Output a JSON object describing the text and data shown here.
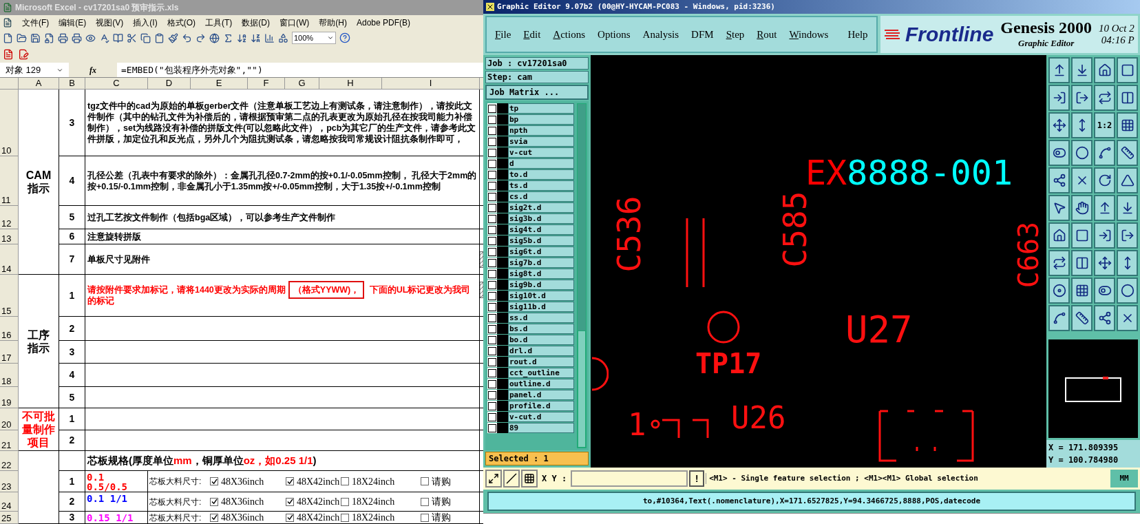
{
  "excel": {
    "title": "Microsoft Excel - cv17201sa0 预审指示.xls",
    "menu": [
      "文件(F)",
      "编辑(E)",
      "视图(V)",
      "插入(I)",
      "格式(O)",
      "工具(T)",
      "数据(D)",
      "窗口(W)",
      "帮助(H)",
      "Adobe PDF(B)"
    ],
    "zoom": "100%",
    "name_box": "对象 129",
    "function_label": "fx",
    "formula": "=EMBED(\"包装程序外壳对象\",\"\")",
    "columns": [
      "A",
      "B",
      "C",
      "D",
      "E",
      "F",
      "G",
      "H",
      "I"
    ],
    "sections": [
      {
        "label": [
          "CAM",
          "指示"
        ],
        "color": "#000000",
        "rows": [
          {
            "number": "10",
            "item": "3",
            "kind": "note",
            "color": "#000000",
            "parts": [
              {
                "text": "tgz文件中的cad为原始的单板gerber文件（注意单板工艺边上有测试条，请注意制作），请按此文件制作（其中的钻孔文件为补偿后的，请根据预审第二点的孔表更改为原始孔径在按我司能力补偿制作），set为线路没有补偿的拼版文件(可以忽略此文件），pcb为其它厂的生产文件，请参考此文件拼版，加定位孔和反光点，另外几个为阻抗测试条，请忽略按我司常规设计阻抗条制作即可，",
                "boxed": false
              }
            ]
          },
          {
            "number": "11",
            "item": "4",
            "kind": "note",
            "color": "#000000",
            "parts": [
              {
                "text": "孔径公差（孔表中有要求的除外）：金属孔孔径0.7-2mm的按+0.1/-0.05mm控制， 孔径大于2mm的按+0.15/-0.1mm控制，非金属孔小于1.35mm按+/-0.05mm控制，大于1.35按+/-0.1mm控制",
                "boxed": false
              }
            ]
          },
          {
            "number": "12",
            "item": "5",
            "kind": "note",
            "color": "#000000",
            "parts": [
              {
                "text": "过孔工艺按文件制作（包括bga区域），可以参考生产文件制作",
                "boxed": false
              }
            ]
          },
          {
            "number": "13",
            "item": "6",
            "kind": "note",
            "color": "#000000",
            "parts": [
              {
                "text": "注意旋转拼版",
                "boxed": false
              }
            ]
          },
          {
            "number": "14",
            "item": "7",
            "kind": "note",
            "color": "#000000",
            "has_object": true,
            "parts": [
              {
                "text": "单板尺寸见附件",
                "boxed": false
              }
            ]
          }
        ]
      },
      {
        "label": [
          "工序",
          "指示"
        ],
        "color": "#000000",
        "rows": [
          {
            "number": "15",
            "item": "1",
            "kind": "note",
            "color": "#ff0000",
            "has_object": true,
            "parts": [
              {
                "text": "请按附件要求加标记，请将1440更改为实际的周期",
                "boxed": false
              },
              {
                "text": "（格式YYWW)，",
                "boxed": true
              },
              {
                "text": " 下面的UL标记更改为我司的标记",
                "boxed": false
              }
            ]
          },
          {
            "number": "16",
            "item": "2",
            "kind": "note",
            "color": "#000000"
          },
          {
            "number": "17",
            "item": "3",
            "kind": "note",
            "color": "#000000"
          },
          {
            "number": "18",
            "item": "4",
            "kind": "note",
            "color": "#000000"
          },
          {
            "number": "19",
            "item": "5",
            "kind": "note",
            "color": "#000000"
          }
        ]
      },
      {
        "label": [
          "不可批",
          "量制作",
          "项目"
        ],
        "color": "#ff0000",
        "rows": [
          {
            "number": "20",
            "item": "1",
            "kind": "note",
            "color": "#000000"
          },
          {
            "number": "21",
            "item": "2",
            "kind": "note",
            "color": "#000000"
          }
        ]
      },
      {
        "color": "#000000",
        "rows": [
          {
            "number": "22",
            "kind": "heading",
            "parts": [
              {
                "text": "芯板规格(厚度单位",
                "color": "#000000"
              },
              {
                "text": "mm",
                "color": "#ff0000"
              },
              {
                "text": "，铜厚单位",
                "color": "#000000"
              },
              {
                "text": "oz，如0.25 1/1",
                "color": "#ff0000"
              },
              {
                "text": ")",
                "color": "#000000"
              }
            ]
          },
          {
            "number": "23",
            "item": "1",
            "kind": "spec",
            "value": "0.1 0.5/0.5",
            "color": "#ff0000",
            "label": "芯板大料尺寸:",
            "options": [
              {
                "label": "48X36inch",
                "checked": true
              },
              {
                "label": "48X42inch",
                "checked": true
              },
              {
                "label": "18X24inch",
                "checked": false
              },
              {
                "label": "请购",
                "checked": false
              }
            ]
          },
          {
            "number": "24",
            "item": "2",
            "kind": "spec",
            "value": "0.1 1/1",
            "color": "#0000ff",
            "label": "芯板大料尺寸:",
            "options": [
              {
                "label": "48X36inch",
                "checked": true
              },
              {
                "label": "48X42inch",
                "checked": true
              },
              {
                "label": "18X24inch",
                "checked": false
              },
              {
                "label": "请购",
                "checked": false
              }
            ]
          },
          {
            "number": "25",
            "item": "3",
            "kind": "spec",
            "value": "0.15 1/1",
            "color": "#ff00ff",
            "label": "芯板大料尺寸:",
            "options": [
              {
                "label": "48X36inch",
                "checked": true
              },
              {
                "label": "48X42inch",
                "checked": true
              },
              {
                "label": "18X24inch",
                "checked": false
              },
              {
                "label": "请购",
                "checked": false
              }
            ]
          }
        ]
      }
    ]
  },
  "genesis": {
    "title": "Graphic Editor 9.07b2 (00@HY-HYCAM-PC083 - Windows, pid:3236)",
    "menu": [
      {
        "label": "File",
        "underlined": true
      },
      {
        "label": "Edit",
        "underlined": true
      },
      {
        "label": "Actions",
        "underlined": true
      },
      {
        "label": "Options",
        "underlined": false
      },
      {
        "label": "Analysis",
        "underlined": false
      },
      {
        "label": "DFM",
        "underlined": false
      },
      {
        "label": "Step",
        "underlined": true
      },
      {
        "label": "Rout",
        "underlined": true
      },
      {
        "label": "Windows",
        "underlined": true
      },
      {
        "label": "Help",
        "underlined": false
      }
    ],
    "brand": "Frontline",
    "product": "Genesis 2000",
    "subtitle": "Graphic Editor",
    "date": "10 Oct 2",
    "time": "04:16 P",
    "job": "Job : cv17201sa0",
    "step": "Step: cam",
    "job_matrix": "Job Matrix ...",
    "layers": [
      {
        "name": "tp",
        "checked": false
      },
      {
        "name": "bp",
        "checked": false
      },
      {
        "name": "npth",
        "checked": false
      },
      {
        "name": "svia",
        "checked": false
      },
      {
        "name": "v-cut",
        "checked": false
      },
      {
        "name": "d",
        "checked": false
      },
      {
        "name": "to.d",
        "checked": false
      },
      {
        "name": "ts.d",
        "checked": false
      },
      {
        "name": "cs.d",
        "checked": false
      },
      {
        "name": "sig2t.d",
        "checked": false
      },
      {
        "name": "sig3b.d",
        "checked": false
      },
      {
        "name": "sig4t.d",
        "checked": false
      },
      {
        "name": "sig5b.d",
        "checked": false
      },
      {
        "name": "sig6t.d",
        "checked": false
      },
      {
        "name": "sig7b.d",
        "checked": false
      },
      {
        "name": "sig8t.d",
        "checked": false
      },
      {
        "name": "sig9b.d",
        "checked": false
      },
      {
        "name": "sig10t.d",
        "checked": false
      },
      {
        "name": "sig11b.d",
        "checked": false
      },
      {
        "name": "ss.d",
        "checked": false
      },
      {
        "name": "bs.d",
        "checked": false
      },
      {
        "name": "bo.d",
        "checked": false
      },
      {
        "name": "drl.d",
        "checked": false
      },
      {
        "name": "rout.d",
        "checked": false
      },
      {
        "name": "cct_outline",
        "checked": false
      },
      {
        "name": "outline.d",
        "checked": false
      },
      {
        "name": "panel.d",
        "checked": false
      },
      {
        "name": "profile.d",
        "checked": false
      },
      {
        "name": "v-cut.d",
        "checked": false
      },
      {
        "name": "89",
        "checked": false
      }
    ],
    "selected": "Selected : 1",
    "canvas": {
      "title_parts": [
        {
          "text": "EX",
          "color": "#ff0000"
        },
        {
          "text": "8888-001",
          "color": "#00ffff"
        }
      ],
      "labels": [
        "C536",
        "C585",
        "C663",
        "U27",
        "TP17",
        "1",
        "U26"
      ]
    },
    "tool_label": "1:2",
    "coord_x": "X = 171.809395",
    "coord_y": "Y = 100.784980",
    "xy_label": "X Y :",
    "bang": "!",
    "hint": "<M1> - Single feature selection ; <M1><M1> Global selection",
    "units": "MM",
    "status": "to,#10364,Text(.nomenclature),X=171.6527825,Y=94.3466725,8888,POS,datecode"
  }
}
